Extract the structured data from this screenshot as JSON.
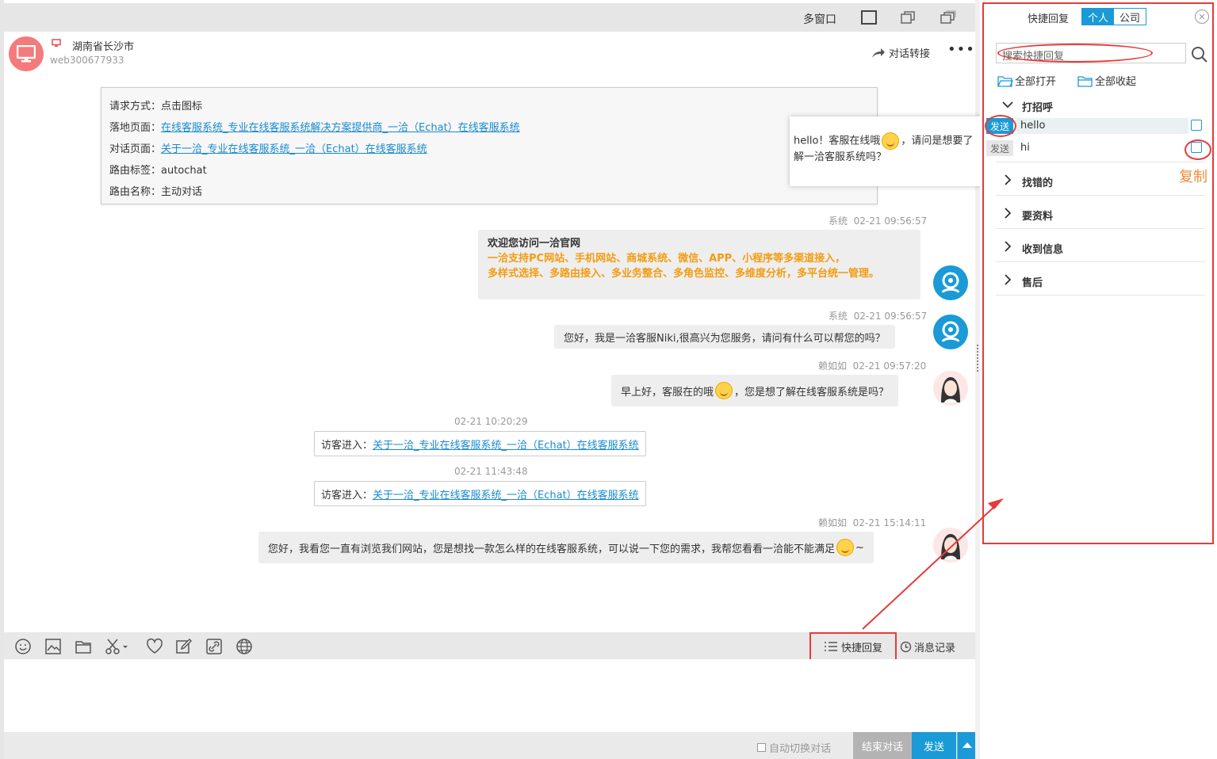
{
  "window": {
    "multi_window_label": "多窗口"
  },
  "visitor": {
    "location": "湖南省长沙市",
    "id": "web300677933",
    "transfer_label": "对话转接",
    "more_label": "•••"
  },
  "info_card": {
    "rows": [
      {
        "label": "请求方式：",
        "value": "点击图标",
        "link": false
      },
      {
        "label": "落地页面：",
        "value": "在线客服系统_专业在线客服系统解决方案提供商_一洽（Echat）在线客服系统",
        "link": true
      },
      {
        "label": "对话页面：",
        "value": "关于一洽_专业在线客服系统_一洽（Echat）在线客服系统",
        "link": true
      },
      {
        "label": "路由标签：",
        "value": "autochat",
        "link": false
      },
      {
        "label": "路由名称：",
        "value": "主动对话",
        "link": false
      }
    ]
  },
  "tooltip": {
    "text_before": "hello！客服在线哦",
    "text_after": "，请问是想要了解一洽客服系统吗？"
  },
  "messages": {
    "m1": {
      "sender": "系统",
      "time": "02-21 09:56:57",
      "title": "欢迎您访问一洽官网",
      "line1": "一洽支持PC网站、手机网站、商城系统、微信、APP、小程序等多渠道接入，",
      "line2": "多样式选择、多路由接入、多业务整合、多角色监控、多维度分析，多平台统一管理。"
    },
    "m2": {
      "sender": "系统",
      "time": "02-21 09:56:57",
      "text": "您好，我是一洽客服Niki,很高兴为您服务，请问有什么可以帮您的吗？"
    },
    "m3": {
      "sender": "赖如如",
      "time": "02-21 09:57:20",
      "text_before": "早上好，客服在的哦",
      "text_after": "，您是想了解在线客服系统是吗？"
    },
    "v1": {
      "time": "02-21 10:20:29",
      "label": "访客进入：",
      "link": "关于一洽_专业在线客服系统_一洽（Echat）在线客服系统"
    },
    "v2": {
      "time": "02-21 11:43:48",
      "label": "访客进入：",
      "link": "关于一洽_专业在线客服系统_一洽（Echat）在线客服系统"
    },
    "m4": {
      "sender": "赖如如",
      "time": "02-21 15:14:11",
      "text_before": "您好，我看您一直有浏览我们网站，您是想找一款怎么样的在线客服系统，可以说一下您的需求，我帮您看看一洽能不能满足",
      "text_after": "~"
    }
  },
  "toolbar": {
    "quick_reply_label": "快捷回复",
    "history_label": "消息记录",
    "icons": [
      "smile-icon",
      "image-icon",
      "folder-icon",
      "scissors-icon",
      "heart-icon",
      "edit-icon",
      "link-icon",
      "globe-icon"
    ]
  },
  "bottom": {
    "auto_switch_label": "自动切换对话",
    "end_label": "结束对话",
    "send_label": "发送"
  },
  "quick_reply": {
    "title": "快捷回复",
    "tab_personal": "个人",
    "tab_company": "公司",
    "search_placeholder": "搜索快捷回复",
    "expand_all": "全部打开",
    "collapse_all": "全部收起",
    "send_tag": "发送",
    "copy_annotation": "复制",
    "groups": [
      {
        "name": "打招呼",
        "expanded": true,
        "items": [
          "hello",
          "hi"
        ]
      },
      {
        "name": "找错的",
        "expanded": false
      },
      {
        "name": "要资料",
        "expanded": false
      },
      {
        "name": "收到信息",
        "expanded": false
      },
      {
        "name": "售后",
        "expanded": false
      }
    ]
  },
  "colors": {
    "accent": "#1a9ad6",
    "annotation_red": "#e53b3b",
    "highlight_orange": "#f39c12"
  }
}
